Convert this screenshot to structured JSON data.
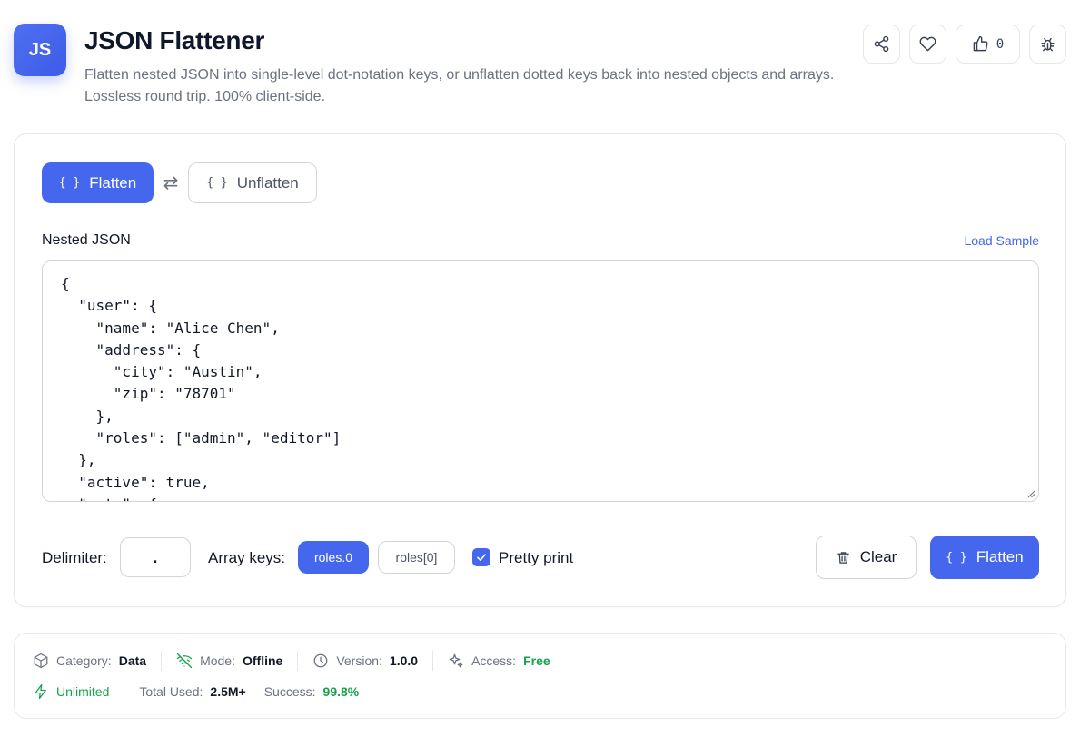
{
  "header": {
    "logo_text": "JS",
    "title": "JSON Flattener",
    "subtitle": "Flatten nested JSON into single-level dot-notation keys, or unflatten dotted keys back into nested objects and arrays. Lossless round trip. 100% client-side.",
    "like_count": "0",
    "icons": [
      "share-icon",
      "heart-icon",
      "thumbs-up-icon",
      "bug-icon"
    ]
  },
  "modes": {
    "flatten_label": "Flatten",
    "unflatten_label": "Unflatten",
    "braces_glyph": "{ }",
    "swap_glyph": "⇄"
  },
  "input": {
    "label": "Nested JSON",
    "load_sample": "Load Sample",
    "value": "{\n  \"user\": {\n    \"name\": \"Alice Chen\",\n    \"address\": {\n      \"city\": \"Austin\",\n      \"zip\": \"78701\"\n    },\n    \"roles\": [\"admin\", \"editor\"]\n  },\n  \"active\": true,\n  \"meta\": {"
  },
  "options": {
    "delimiter_label": "Delimiter:",
    "delimiter_value": ".",
    "array_keys_label": "Array keys:",
    "array_key_options": [
      "roles.0",
      "roles[0]"
    ],
    "array_key_selected": "roles.0",
    "pretty_print_label": "Pretty print",
    "pretty_print_checked": true
  },
  "actions": {
    "clear_label": "Clear",
    "run_label": "Flatten"
  },
  "info": {
    "category_label": "Category:",
    "category_value": "Data",
    "mode_label": "Mode:",
    "mode_value": "Offline",
    "version_label": "Version:",
    "version_value": "1.0.0",
    "access_label": "Access:",
    "access_value": "Free",
    "unlimited_label": "Unlimited",
    "total_used_label": "Total Used:",
    "total_used_value": "2.5M+",
    "success_label": "Success:",
    "success_value": "99.8%"
  },
  "colors": {
    "accent": "#4467ee",
    "success": "#16a34a",
    "border": "#e5e7eb"
  }
}
